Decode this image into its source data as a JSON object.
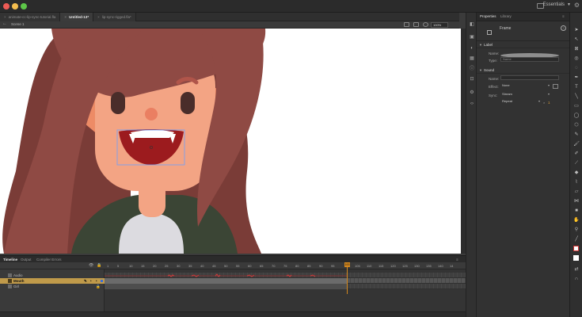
{
  "app": {
    "workspace": "Essentials"
  },
  "doc_tabs": [
    {
      "label": "animate-cc-lip-sync-tutorial.fla",
      "active": false
    },
    {
      "label": "Untitled-13*",
      "active": true
    },
    {
      "label": "lip-sync-rigged.fla*",
      "active": false
    }
  ],
  "scene": {
    "label": "Scene 1",
    "zoom": "100%"
  },
  "properties": {
    "tabs": [
      "Properties",
      "Library"
    ],
    "selection": "Frame",
    "label_section": "Label",
    "name_label": "Name:",
    "type_label": "Type:",
    "type_value": "Name",
    "sound_section": "Sound",
    "sound_name_label": "Name:",
    "effect_label": "Effect:",
    "effect_value": "None",
    "sync_label": "Sync:",
    "sync_value": "Stream",
    "repeat_value": "Repeat",
    "repeat_count": "1"
  },
  "timeline": {
    "tabs": [
      "Timeline",
      "Output",
      "Compiler Errors"
    ],
    "layers": [
      {
        "name": "Audio",
        "selected": false
      },
      {
        "name": "Mouth",
        "selected": true
      },
      {
        "name": "Girl",
        "selected": false
      }
    ],
    "frame_numbers": [
      "1",
      "5",
      "10",
      "15",
      "20",
      "25",
      "30",
      "35",
      "40",
      "45",
      "50",
      "55",
      "60",
      "65",
      "70",
      "75",
      "80",
      "85",
      "90",
      "95",
      "100",
      "105",
      "110",
      "115",
      "120",
      "125",
      "130",
      "135",
      "140",
      "14"
    ],
    "current_frame": "100"
  },
  "colors": {
    "accent": "#d4881e",
    "hair": "#8f4a44",
    "skin": "#f3a484",
    "mouth": "#9c1b1e",
    "shirt": "#3b4535"
  }
}
